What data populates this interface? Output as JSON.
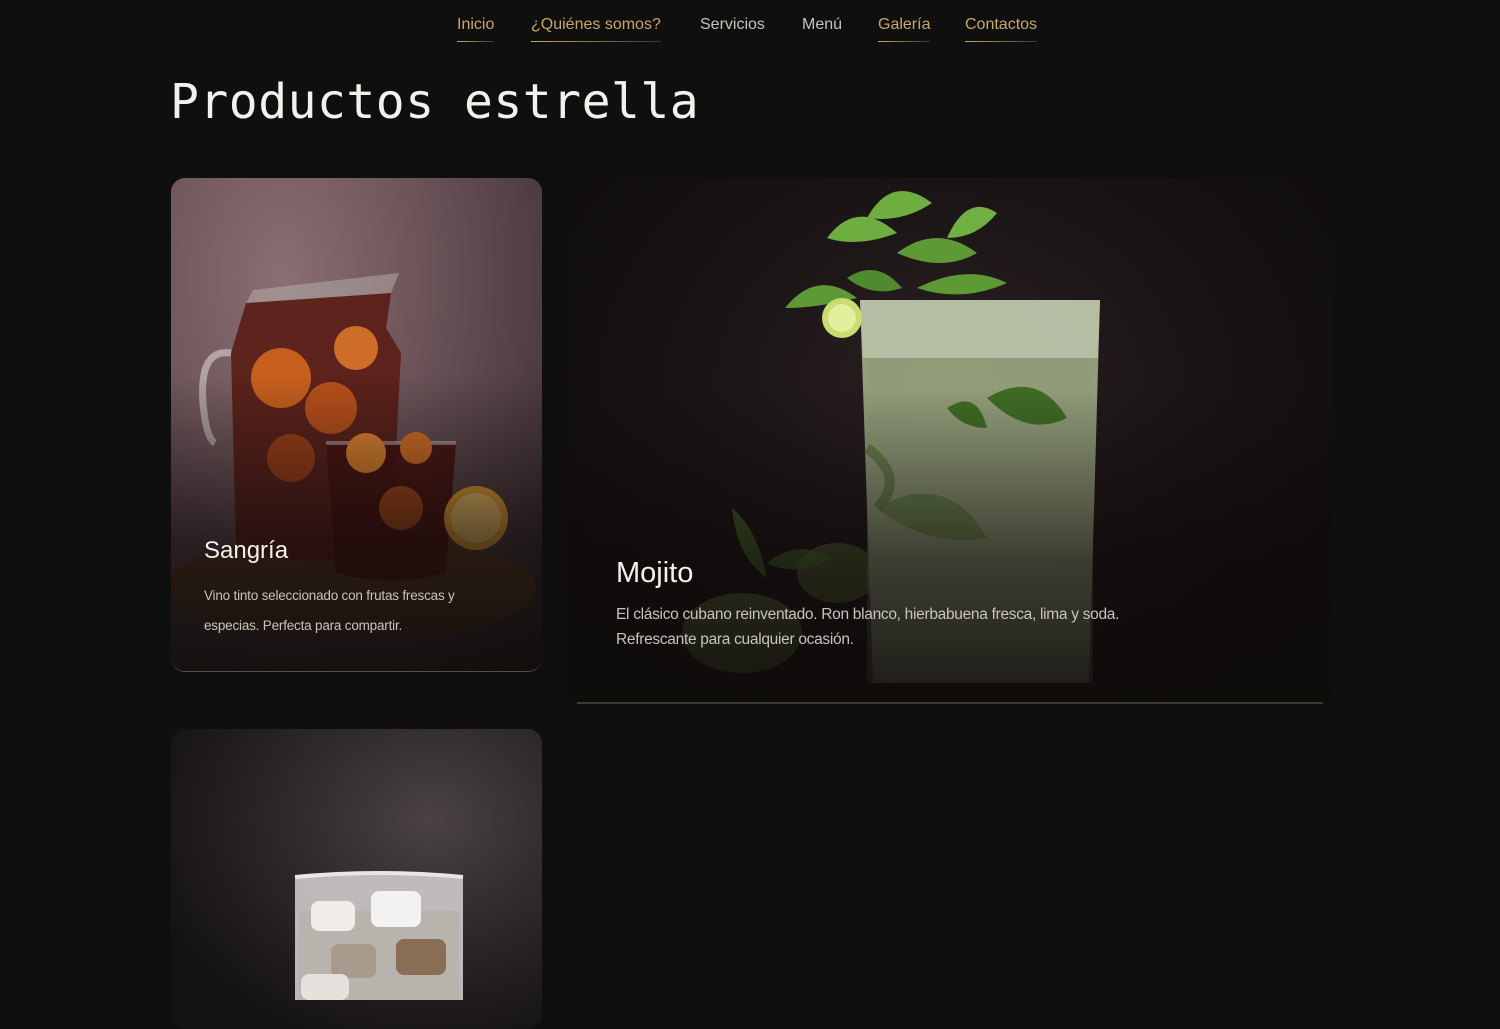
{
  "nav": {
    "items": [
      {
        "label": "Inicio",
        "active": true
      },
      {
        "label": "¿Quiénes somos?",
        "active": true
      },
      {
        "label": "Servicios",
        "active": false
      },
      {
        "label": "Menú",
        "active": false
      },
      {
        "label": "Galería",
        "active": true
      },
      {
        "label": "Contactos",
        "active": true
      }
    ]
  },
  "main": {
    "title": "Productos estrella",
    "products": [
      {
        "name": "Sangría",
        "description": "Vino tinto seleccionado con frutas frescas y especias. Perfecta para compartir."
      },
      {
        "name": "Mojito",
        "description": "El clásico cubano reinventado. Ron blanco, hierbabuena fresca, lima y soda. Refrescante para cualquier ocasión."
      },
      {
        "name": "",
        "description": ""
      }
    ]
  },
  "colors": {
    "background": "#0f0f0f",
    "accent": "#c9a66b",
    "text": "#f3f1ec",
    "muted": "#c9c4bb"
  },
  "icons": {
    "sangria_image": "sangria-pitcher-icon",
    "mojito_image": "mojito-glass-icon",
    "third_image": "iced-coffee-glass-icon"
  }
}
